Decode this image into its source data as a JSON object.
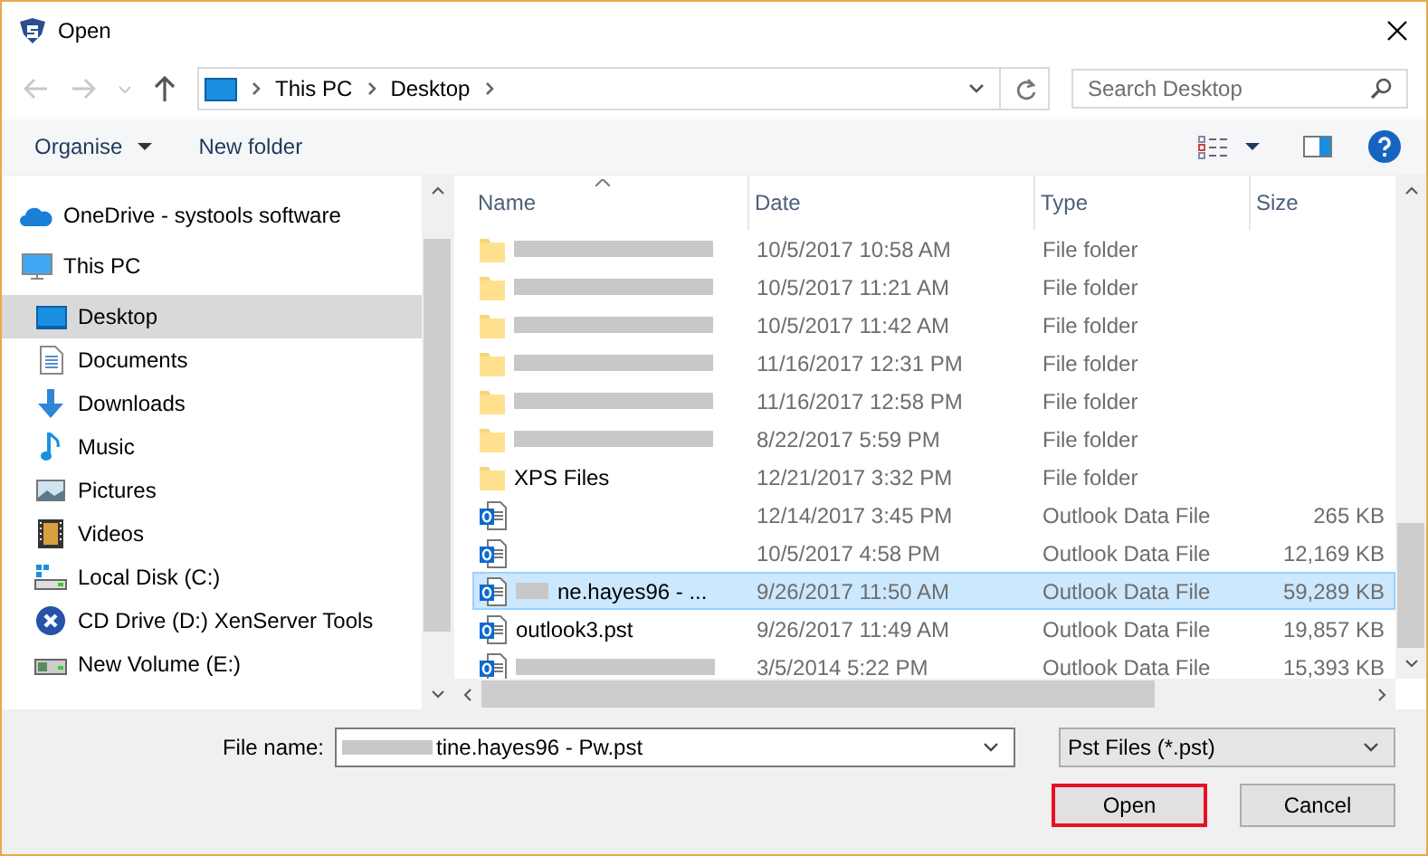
{
  "window": {
    "title": "Open"
  },
  "address": {
    "crumbs": [
      "This PC",
      "Desktop"
    ]
  },
  "search": {
    "placeholder": "Search Desktop"
  },
  "toolbar": {
    "organise": "Organise",
    "new_folder": "New folder"
  },
  "sidebar": {
    "items": [
      {
        "kind": "cloud",
        "label": "OneDrive - systools software",
        "selected": false
      },
      {
        "kind": "pc",
        "label": "This PC",
        "selected": false,
        "children": [
          {
            "kind": "desktop",
            "label": "Desktop",
            "selected": true
          },
          {
            "kind": "doc",
            "label": "Documents",
            "selected": false
          },
          {
            "kind": "download",
            "label": "Downloads",
            "selected": false
          },
          {
            "kind": "music",
            "label": "Music",
            "selected": false
          },
          {
            "kind": "picture",
            "label": "Pictures",
            "selected": false
          },
          {
            "kind": "video",
            "label": "Videos",
            "selected": false
          },
          {
            "kind": "disk",
            "label": "Local Disk (C:)",
            "selected": false
          },
          {
            "kind": "cd",
            "label": "CD Drive (D:) XenServer Tools",
            "selected": false
          },
          {
            "kind": "volume",
            "label": "New Volume (E:)",
            "selected": false
          }
        ]
      }
    ]
  },
  "table": {
    "columns": [
      "Name",
      "Date",
      "Type",
      "Size"
    ],
    "rows": [
      {
        "kind": "folder",
        "redacted": true,
        "date": "10/5/2017 10:58 AM",
        "type": "File folder",
        "selected": false
      },
      {
        "kind": "folder",
        "redacted": true,
        "date": "10/5/2017 11:21 AM",
        "type": "File folder",
        "selected": false
      },
      {
        "kind": "folder",
        "redacted": true,
        "date": "10/5/2017 11:42 AM",
        "type": "File folder",
        "selected": false
      },
      {
        "kind": "folder",
        "redacted": true,
        "date": "11/16/2017 12:31 PM",
        "type": "File folder",
        "selected": false
      },
      {
        "kind": "folder",
        "redacted": true,
        "date": "11/16/2017 12:58 PM",
        "type": "File folder",
        "selected": false
      },
      {
        "kind": "folder",
        "redacted": true,
        "date": "8/22/2017 5:59 PM",
        "type": "File folder",
        "selected": false
      },
      {
        "kind": "folder",
        "redacted": false,
        "name": "XPS Files",
        "date": "12/21/2017 3:32 PM",
        "type": "File folder",
        "selected": false
      },
      {
        "kind": "pst",
        "redacted": false,
        "date": "12/14/2017 3:45 PM",
        "type": "Outlook Data File",
        "size": "265 KB",
        "selected": false
      },
      {
        "kind": "pst",
        "redacted": false,
        "date": "10/5/2017 4:58 PM",
        "type": "Outlook Data File",
        "size": "12,169 KB",
        "selected": false
      },
      {
        "kind": "pst",
        "redacted": true,
        "name": "ne.hayes96 - ...",
        "date": "9/26/2017 11:50 AM",
        "type": "Outlook Data File",
        "size": "59,289 KB",
        "selected": true
      },
      {
        "kind": "pst",
        "redacted": false,
        "name": "outlook3.pst",
        "date": "9/26/2017 11:49 AM",
        "type": "Outlook Data File",
        "size": "19,857 KB",
        "selected": false
      },
      {
        "kind": "pst",
        "redacted": true,
        "date": "3/5/2014 5:22 PM",
        "type": "Outlook Data File",
        "size": "15,393 KB",
        "selected": false
      }
    ]
  },
  "footer": {
    "file_name_label": "File name:",
    "file_name": {
      "value": "tine.hayes96 - Pw.pst",
      "redacted": true
    },
    "file_type": "Pst Files (*.pst)",
    "buttons": [
      {
        "label": "Open",
        "highlighted": true
      },
      {
        "label": "Cancel",
        "highlighted": false
      }
    ]
  }
}
